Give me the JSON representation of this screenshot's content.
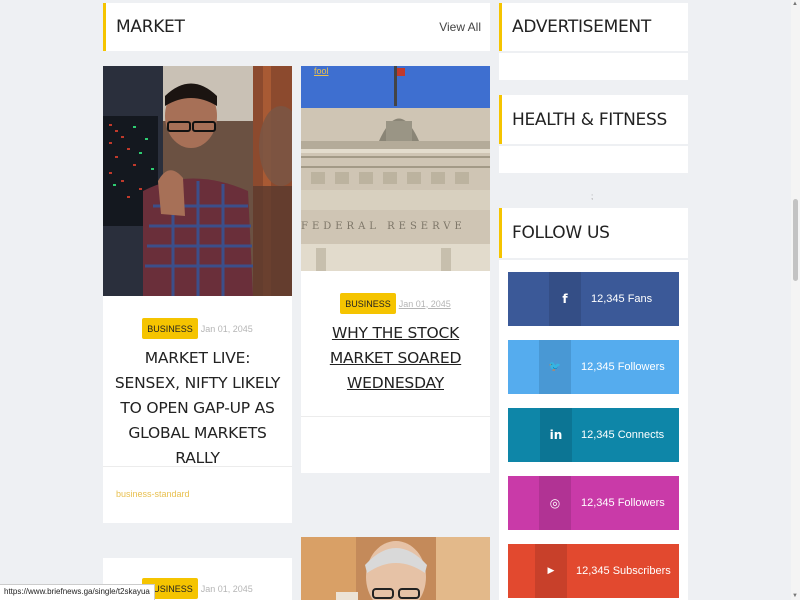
{
  "market": {
    "title": "MARKET",
    "view_all": "View All"
  },
  "sidebar": {
    "advertisement_title": "ADVERTISEMENT",
    "health_title": "HEALTH & FITNESS",
    "follow_title": "FOLLOW US",
    "divider_mark": ";"
  },
  "cards": [
    {
      "badge": "BUSINESS",
      "date": "Jan 01, 2045",
      "headline": "MARKET LIVE: SENSEX, NIFTY LIKELY TO OPEN GAP-UP AS GLOBAL MARKETS RALLY",
      "source": "business-standard"
    },
    {
      "badge": "BUSINESS",
      "date": "Jan 01, 2045",
      "headline": "WHY THE STOCK MARKET SOARED WEDNESDAY",
      "source": "fool"
    },
    {
      "badge": "BUSINESS",
      "date": "Jan 01, 2045"
    }
  ],
  "building_inscription": "FEDERAL  RESERVE",
  "social": [
    {
      "network": "facebook",
      "icon": "f",
      "text": "12,345 Fans",
      "color": "#3b5998",
      "icon_color": "#344e86"
    },
    {
      "network": "twitter",
      "icon": "🐦",
      "text": "12,345 Followers",
      "color": "#55acee",
      "icon_color": "#4998d4"
    },
    {
      "network": "linkedin",
      "icon": "in",
      "text": "12,345 Connects",
      "color": "#0e86a8",
      "icon_color": "#0c7594"
    },
    {
      "network": "instagram",
      "icon": "◎",
      "text": "12,345 Followers",
      "color": "#c93aa8",
      "icon_color": "#b13394"
    },
    {
      "network": "youtube",
      "icon": "▶",
      "text": "12,345 Subscribers",
      "color": "#e2492f",
      "icon_color": "#c8402a"
    }
  ],
  "status_url": "https://www.briefnews.ga/single/t2skayua",
  "scrollbar": {
    "up": "▲",
    "down": "▼"
  }
}
